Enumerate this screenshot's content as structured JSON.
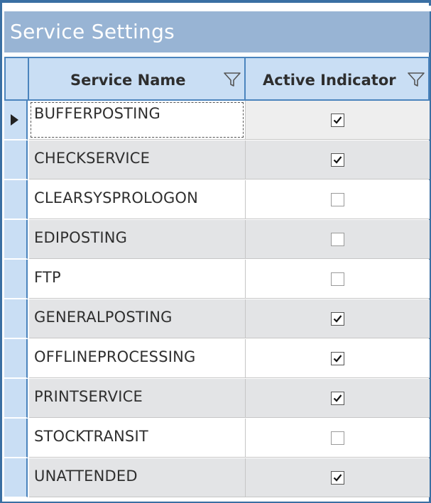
{
  "window": {
    "title": "Service Settings"
  },
  "grid": {
    "columns": [
      {
        "label": "Service Name",
        "filter_icon": "filter-funnel-icon"
      },
      {
        "label": "Active Indicator",
        "filter_icon": "filter-funnel-icon"
      }
    ],
    "current_row_indicator_icon": "current-row-arrow-icon",
    "rows": [
      {
        "service_name": "BUFFERPOSTING",
        "active": true
      },
      {
        "service_name": "CHECKSERVICE",
        "active": true
      },
      {
        "service_name": "CLEARSYSPROLOGON",
        "active": false
      },
      {
        "service_name": "EDIPOSTING",
        "active": false
      },
      {
        "service_name": "FTP",
        "active": false
      },
      {
        "service_name": "GENERALPOSTING",
        "active": true
      },
      {
        "service_name": "OFFLINEPROCESSING",
        "active": true
      },
      {
        "service_name": "PRINTSERVICE",
        "active": true
      },
      {
        "service_name": "STOCKTRANSIT",
        "active": false
      },
      {
        "service_name": "UNATTENDED",
        "active": true
      }
    ]
  },
  "colors": {
    "title_bar": "#98b4d4",
    "header_bg": "#c9def4",
    "header_border": "#4b84bd",
    "alt_row": "#e3e4e6"
  }
}
